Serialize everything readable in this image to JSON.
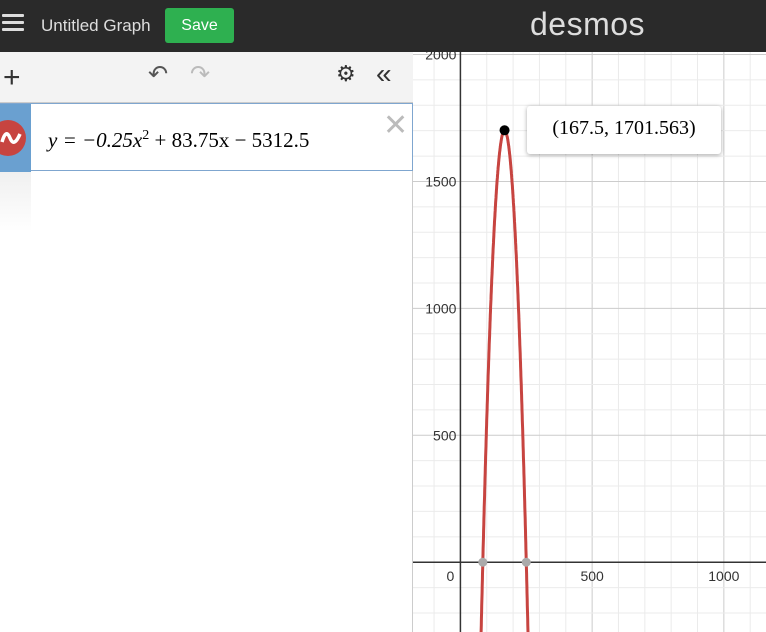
{
  "header": {
    "title": "Untitled Graph",
    "save_label": "Save",
    "logo": "desmos"
  },
  "toolbar": {
    "add": "+",
    "undo": "↶",
    "redo": "↷",
    "settings": "⚙",
    "collapse": "«"
  },
  "expression": {
    "latex": "y = −0.25x² + 83.75x − 5312.5",
    "text_a": "y = −0.25x",
    "sup": "2",
    "text_b": " + 83.75x − 5312.5",
    "color": "#c74440"
  },
  "graph": {
    "x_range": [
      -180,
      1160
    ],
    "y_range": [
      -275,
      2010
    ],
    "x_ticks": [
      0,
      500,
      1000
    ],
    "y_ticks": [
      500,
      1000,
      1500,
      2000
    ],
    "origin_label": "0",
    "curve": {
      "a": -0.25,
      "b": 83.75,
      "c": -5312.5
    },
    "vertex": [
      167.5,
      1701.563
    ],
    "roots": [
      85,
      250
    ],
    "tooltip": "(167.5, 1701.563)"
  }
}
